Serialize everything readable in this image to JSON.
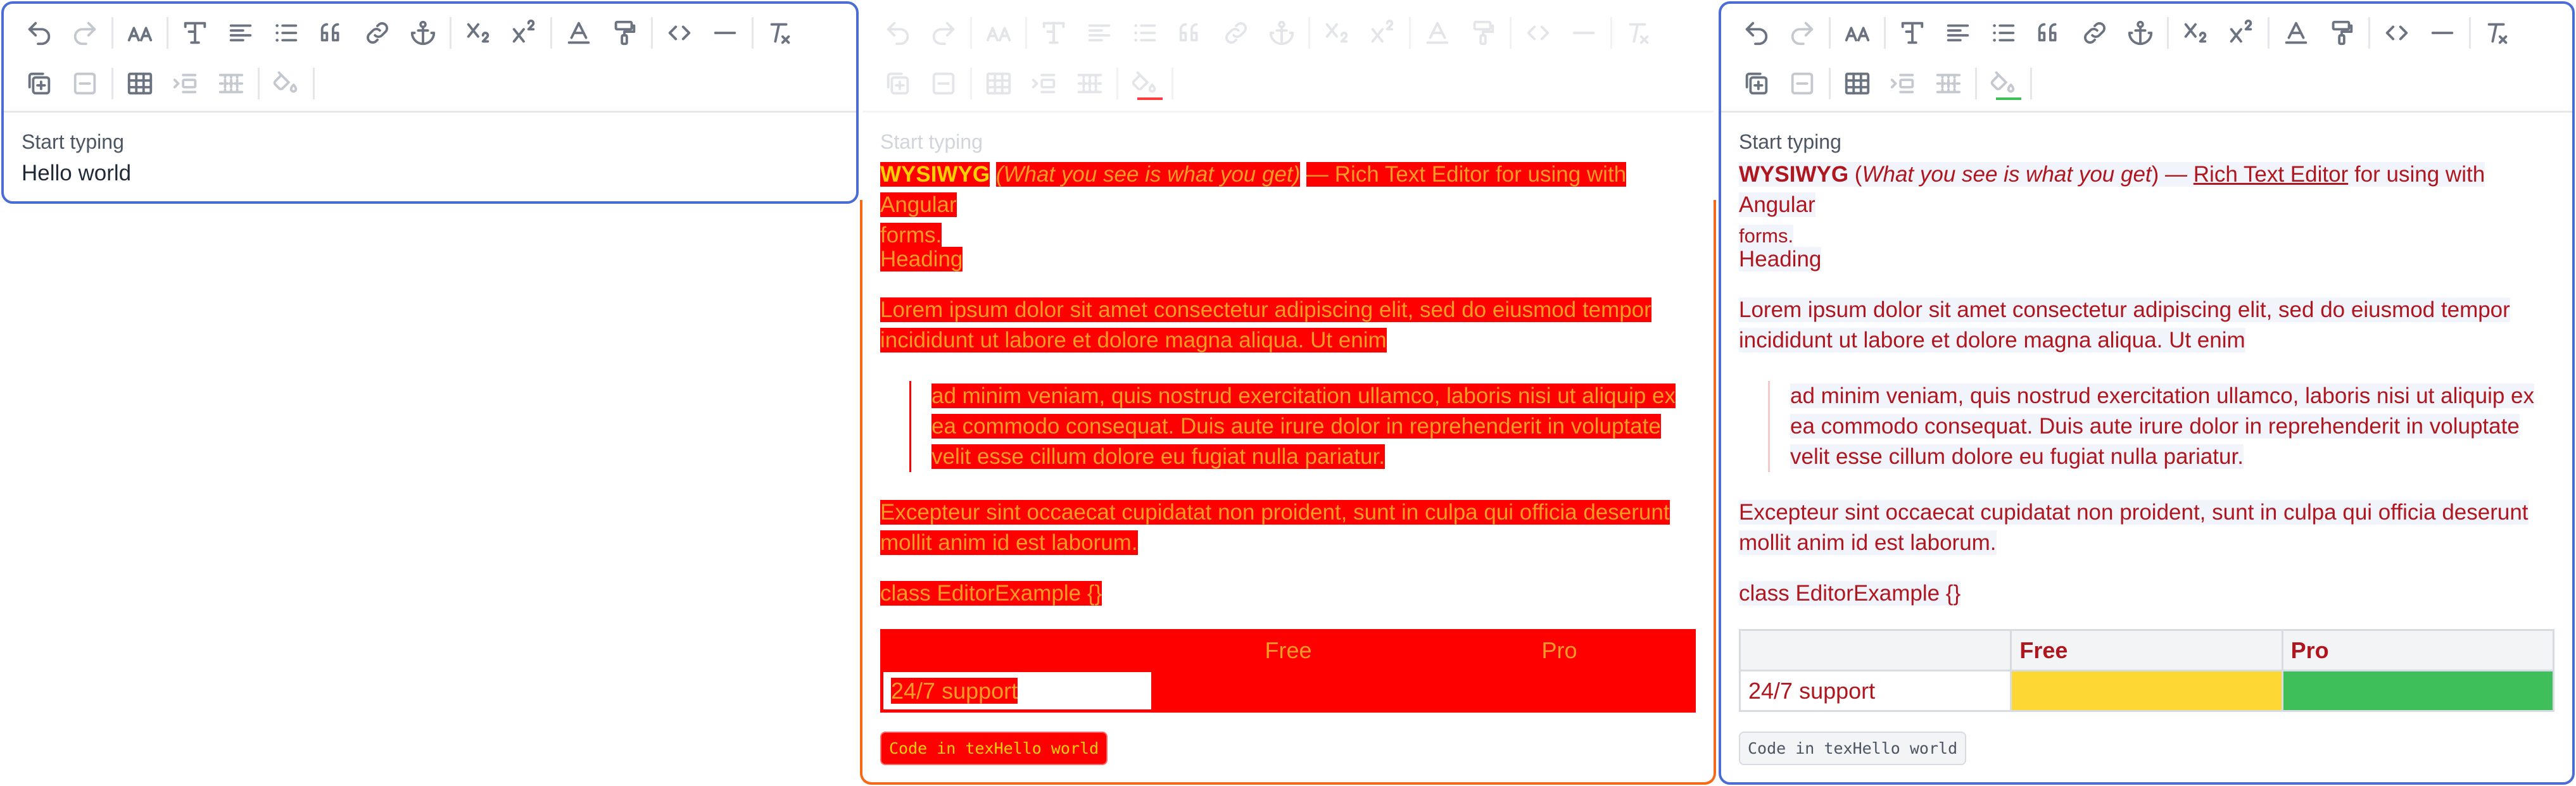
{
  "toolbar": {
    "row1": [
      "undo-icon",
      "redo-icon",
      "sep",
      "font-size-icon",
      "sep",
      "text-style-icon",
      "align-icon",
      "list-icon",
      "quote-icon",
      "link-icon",
      "anchor-icon",
      "sep",
      "subscript-icon",
      "superscript-icon",
      "sep",
      "text-color-icon",
      "format-painter-icon",
      "sep",
      "code-icon",
      "horizontal-rule-icon",
      "sep",
      "clear-format-icon"
    ],
    "row2": [
      "insert-block-icon",
      "remove-block-icon",
      "sep",
      "table-icon",
      "indent-icon",
      "table-cells-icon",
      "sep",
      "fill-color-icon",
      "sep"
    ],
    "fill_underline_red": "#ff3b3b",
    "fill_underline_green": "#3fbf5a"
  },
  "editor1": {
    "placeholder": "Start typing",
    "text": "Hello world"
  },
  "editor2": {
    "placeholder": "Start typing",
    "title_bold": "WYSIWYG",
    "title_paren": "(What you see is what you get)",
    "title_rest": "— Rich Text Editor for using with Angular",
    "title_rest2": "forms.",
    "heading": "Heading",
    "para1_line1": "Lorem ipsum dolor sit amet consectetur adipiscing elit, sed do eiusmod tempor",
    "para1_line2": "incididunt ut labore et dolore magna aliqua. Ut enim",
    "quote_line1": "ad minim veniam, quis nostrud exercitation ullamco, laboris nisi ut aliquip ex",
    "quote_line2": "ea commodo consequat. Duis aute irure dolor in reprehenderit in voluptate",
    "quote_line3": "velit esse cillum dolore eu fugiat nulla pariatur.",
    "para2_line1": "Excepteur sint occaecat cupidatat non proident, sunt in culpa qui officia deserunt",
    "para2_line2": "mollit anim id est laborum.",
    "code_line": "class EditorExample {}",
    "table_head": [
      "",
      "Free",
      "Pro"
    ],
    "table_row": [
      "24/7 support",
      "",
      ""
    ],
    "code_chip": "Code in texHello world"
  },
  "editor3": {
    "placeholder": "Start typing",
    "title_bold": "WYSIWYG",
    "title_open": "(",
    "title_italic": "What you see is what you get",
    "title_close": ") —",
    "title_link": "Rich Text Editor",
    "title_rest": "for using with Angular",
    "title_rest2": "forms.",
    "heading": "Heading",
    "para1_line1": "Lorem ipsum dolor sit amet consectetur adipiscing elit, sed do eiusmod tempor",
    "para1_line2": "incididunt ut labore et dolore magna aliqua. Ut enim",
    "quote_line1": "ad minim veniam, quis nostrud exercitation ullamco, laboris nisi ut aliquip ex",
    "quote_line2": "ea commodo consequat. Duis aute irure dolor in reprehenderit in voluptate",
    "quote_line3": "velit esse cillum dolore eu fugiat nulla pariatur.",
    "para2_line1": "Excepteur sint occaecat cupidatat non proident, sunt in culpa qui officia deserunt",
    "para2_line2": "mollit anim id est laborum.",
    "code_line": "class EditorExample {}",
    "table_head": [
      "",
      "Free",
      "Pro"
    ],
    "table_row": [
      "24/7 support",
      "",
      ""
    ],
    "cell_colors": {
      "free": "#fdd835",
      "pro": "#3fbf5a"
    },
    "code_chip": "Code in texHello world"
  },
  "colors": {
    "border_blue": "#4a6cd4",
    "border_orange": "#f56a16",
    "invert_red": "#ff0000",
    "invert_orange": "#ff9a22",
    "text_red": "#b0161e"
  }
}
